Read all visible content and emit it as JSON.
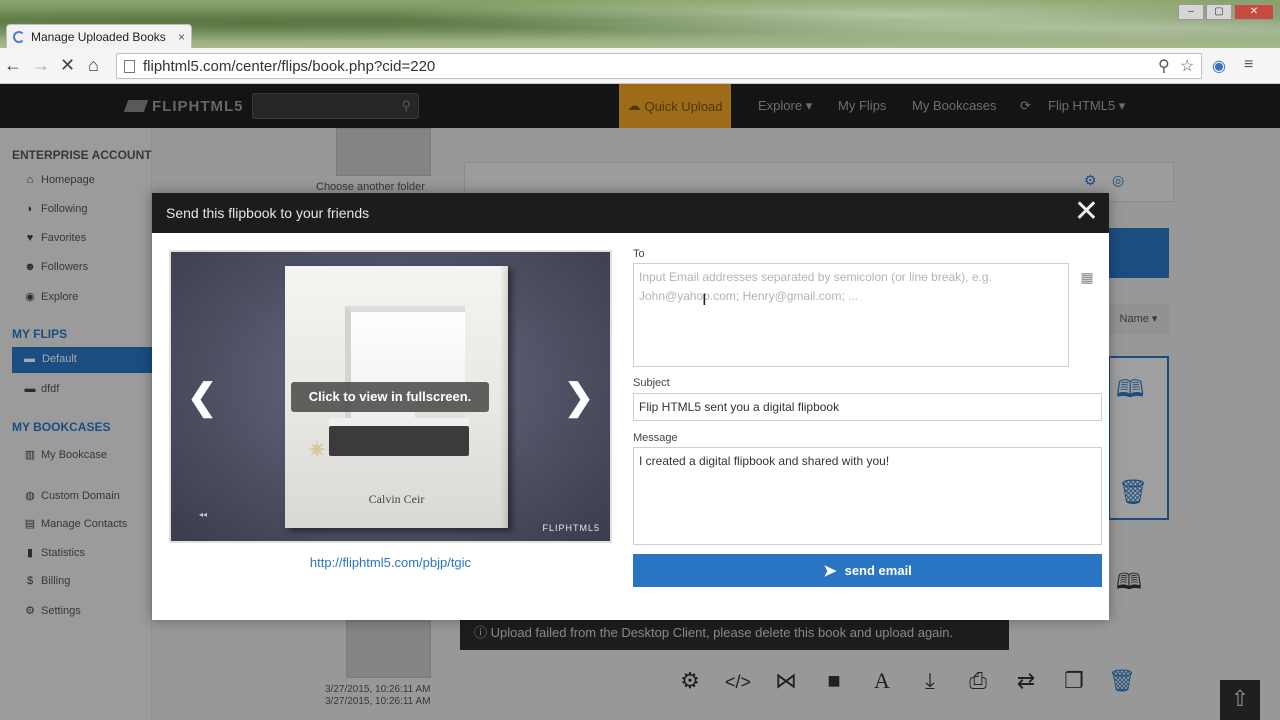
{
  "browser": {
    "tab_title": "Manage Uploaded Books",
    "tab_close": "×",
    "url": "fliphtml5.com/center/flips/book.php?cid=220"
  },
  "site": {
    "logo": "FLIPHTML5",
    "quick_upload": "Quick Upload",
    "nav": [
      "Explore ▾",
      "My Flips",
      "My Bookcases",
      "Flip HTML5 ▾"
    ]
  },
  "sidebar": {
    "enterprise_heading": "ENTERPRISE ACCOUNT",
    "enterprise_items": [
      "Homepage",
      "Following",
      "Favorites",
      "Followers",
      "Explore"
    ],
    "my_flips_heading": "MY FLIPS",
    "flips": [
      "Default",
      "dfdf"
    ],
    "bookcases_heading": "MY BOOKCASES",
    "bookcases": [
      "My Bookcase"
    ],
    "other_items": [
      "Custom Domain",
      "Manage Contacts",
      "Statistics",
      "Billing",
      "Settings"
    ]
  },
  "background": {
    "choose_folder": "Choose another folder",
    "sort_label": "Name ▾",
    "error_message": "Upload failed from the Desktop Client, please delete this book and upload again.",
    "date_1": "3/27/2015, 10:26:11 AM",
    "date_2": "3/27/2015, 10:26:11 AM"
  },
  "modal": {
    "title": "Send this flipbook to your friends",
    "close": "✕",
    "preview_label": "Click to view in fullscreen.",
    "book_brand": "Calvin Ceir",
    "preview_logo": "FLIPHTML5",
    "book_link": "http://fliphtml5.com/pbjp/tgic",
    "to_label": "To",
    "to_placeholder": "Input Email addresses separated by semicolon (or line break), e.g. John@yahoo.com; Henry@gmail.com; ...",
    "subject_label": "Subject",
    "subject_value": "Flip HTML5 sent you a digital flipbook",
    "message_label": "Message",
    "message_value": "I created a digital flipbook and shared with you!",
    "send_label": "send email"
  },
  "colors": {
    "accent": "#2a75c2",
    "quick_upload": "#f0a325",
    "header": "#1f1f1f"
  }
}
